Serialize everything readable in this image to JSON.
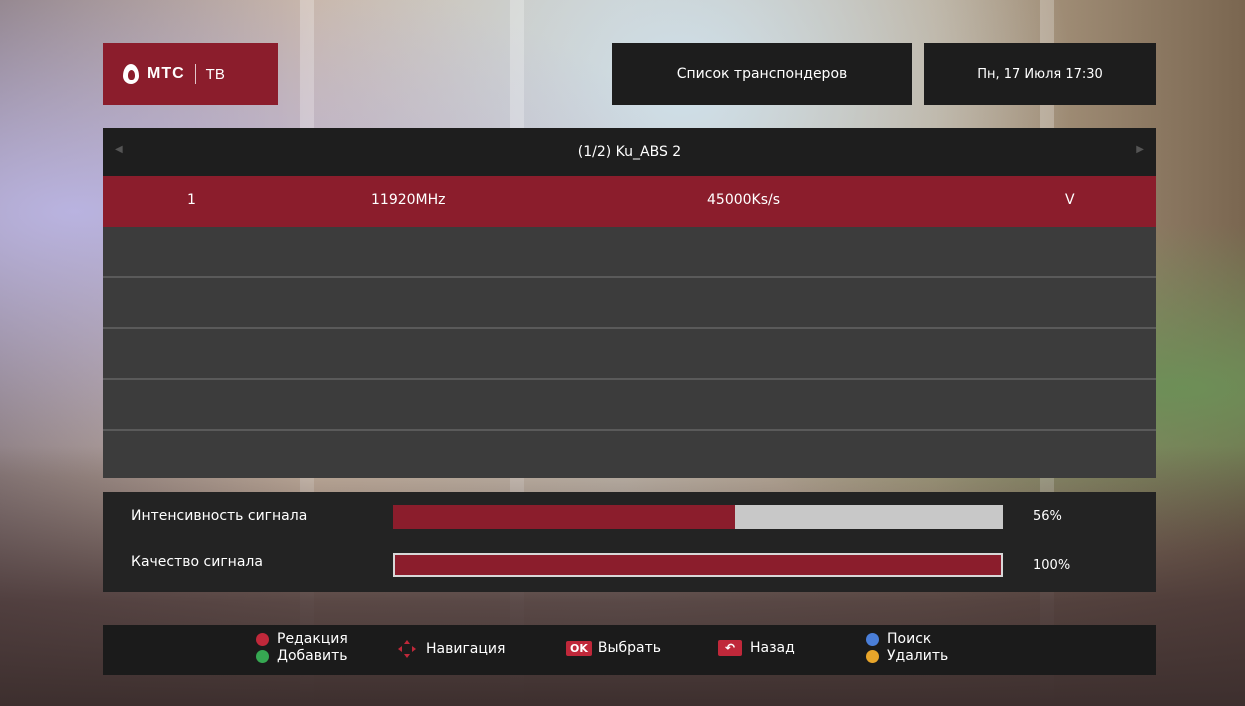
{
  "header": {
    "brand": "МТС",
    "brand_suffix": "ТВ",
    "title": "Список транспондеров",
    "datetime": "Пн, 17 Июля 17:30"
  },
  "list": {
    "satellite_label": "(1/2) Ku_ABS 2",
    "rows": [
      {
        "num": "1",
        "frequency": "11920MHz",
        "symbol_rate": "45000Ks/s",
        "polarization": "V"
      },
      {
        "num": "",
        "frequency": "",
        "symbol_rate": "",
        "polarization": ""
      },
      {
        "num": "",
        "frequency": "",
        "symbol_rate": "",
        "polarization": ""
      },
      {
        "num": "",
        "frequency": "",
        "symbol_rate": "",
        "polarization": ""
      },
      {
        "num": "",
        "frequency": "",
        "symbol_rate": "",
        "polarization": ""
      },
      {
        "num": "",
        "frequency": "",
        "symbol_rate": "",
        "polarization": ""
      }
    ]
  },
  "signal": {
    "intensity_label": "Интенсивность сигнала",
    "intensity_value": "56%",
    "intensity_fraction": 0.56,
    "quality_label": "Качество сигнала",
    "quality_value": "100%",
    "quality_fraction": 1.0
  },
  "footer": {
    "edit": "Редакция",
    "add": "Добавить",
    "navigate": "Навигация",
    "ok_badge": "OK",
    "select": "Выбрать",
    "back": "Назад",
    "search": "Поиск",
    "delete": "Удалить"
  },
  "colors": {
    "accent": "#8b1d2c",
    "key_red": "#c0283a",
    "key_green": "#36a852",
    "key_blue": "#4a7ed8",
    "key_yellow": "#e8a52a"
  }
}
